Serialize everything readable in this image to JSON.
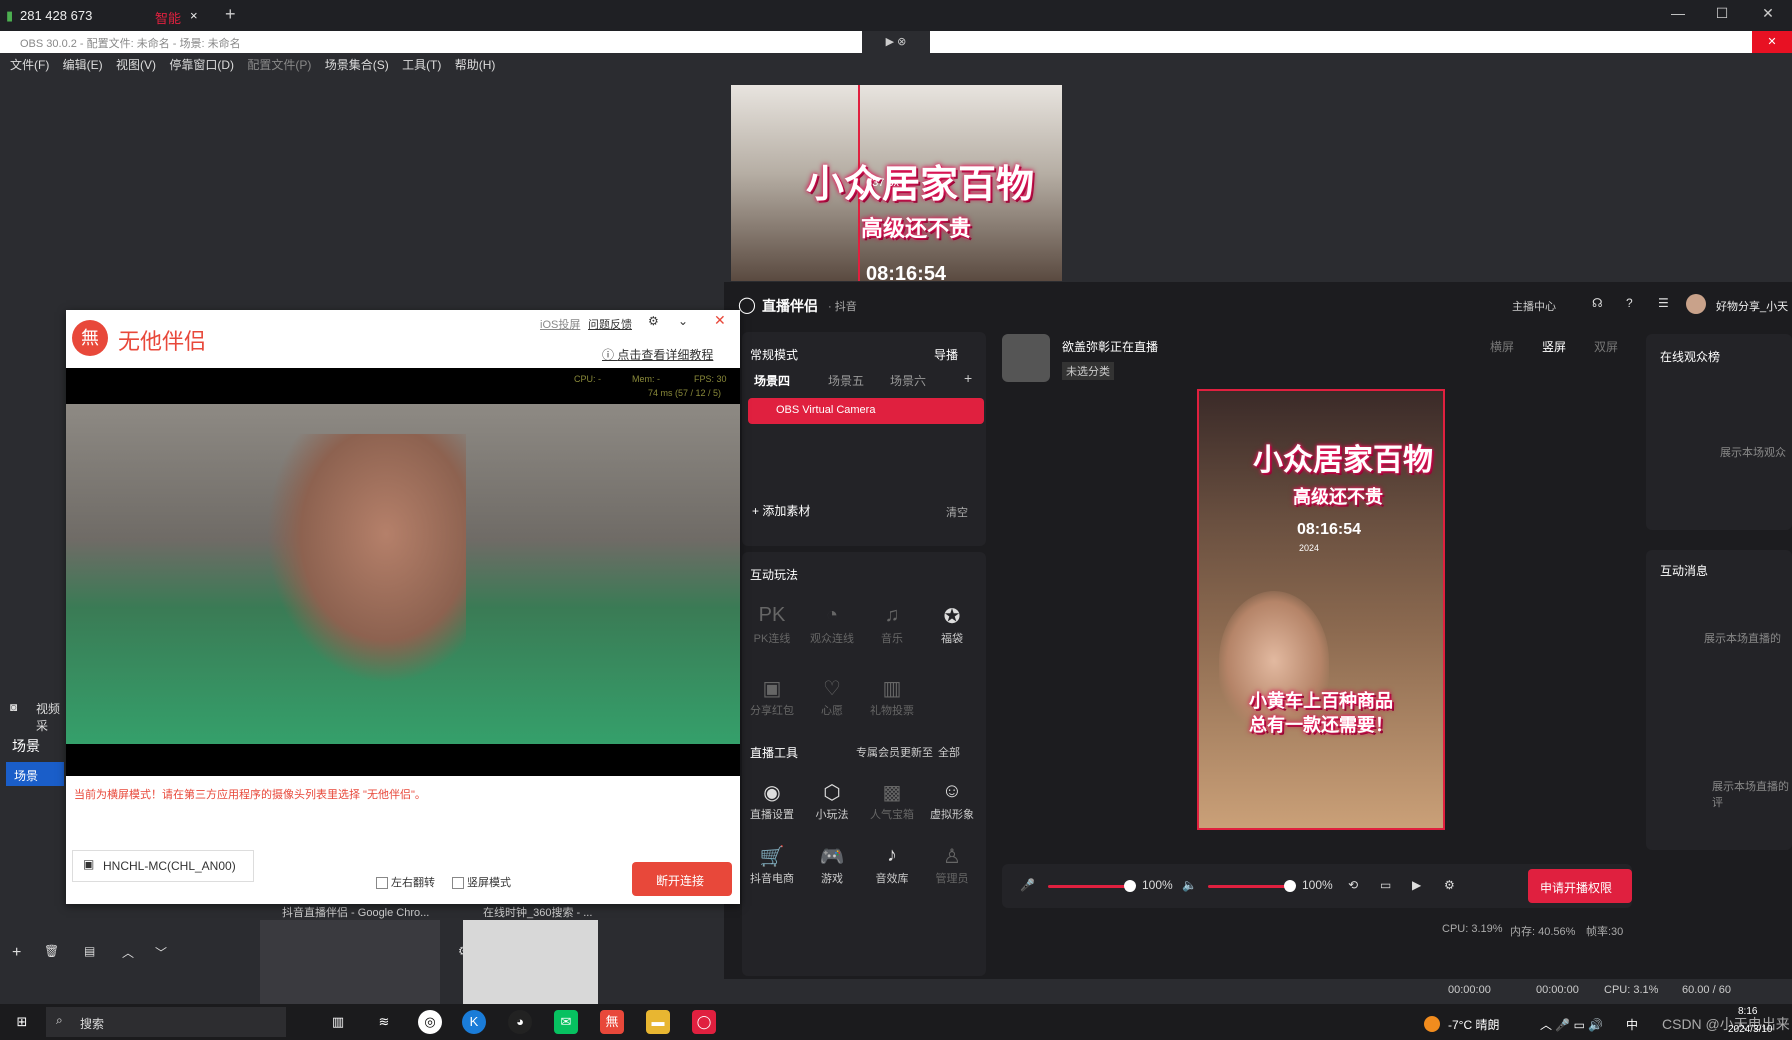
{
  "browser": {
    "tab_counter": "281 428 673",
    "tab_label": "智能",
    "new_tab": "+"
  },
  "obs": {
    "title": "OBS 30.0.2 - 配置文件: 未命名 - 场景: 未命名",
    "menu": [
      "文件(F)",
      "编辑(E)",
      "视图(V)",
      "停靠窗口(D)",
      "配置文件(P)",
      "场景集合(S)",
      "工具(T)",
      "帮助(H)"
    ],
    "left": {
      "video_label": "视频采",
      "scenes_header": "场景",
      "scene_item": "场景"
    },
    "status": {
      "t1": "00:00:00",
      "t2": "00:00:00",
      "cpu": "CPU: 3.1%",
      "fps": "60.00 / 60"
    }
  },
  "preview": {
    "title": "小众居家百物",
    "subtitle": "高级还不贵",
    "time": "08:16:54",
    "px": "637 px"
  },
  "wt": {
    "logo": "无他伴侣",
    "ios": "iOS投屏",
    "feedback": "问题反馈",
    "tutorial": "点击查看详细教程",
    "stats": {
      "cpu": "CPU: -",
      "mem": "Mem: -",
      "fps": "FPS: 30",
      "ms": "74 ms (57 / 12 / 5)"
    },
    "warning": "当前为横屏模式！请在第三方应用程序的摄像头列表里选择 \"无他伴侣\"。",
    "device": "HNCHL-MC(CHL_AN00)",
    "flip": "左右翻转",
    "portrait": "竖屏模式",
    "disconnect": "断开连接"
  },
  "thumbs": [
    "抖音直播伴侣 - Google Chro...",
    "在线时钟_360搜索 - ..."
  ],
  "zb": {
    "brand": "直播伴侣",
    "platform": "· 抖音",
    "header_right": [
      "主播中心",
      "好物分享_小天"
    ],
    "mode": "常规模式",
    "guide": "导播",
    "scenes": [
      "场景四",
      "场景五",
      "场景六"
    ],
    "source": "OBS Virtual Camera",
    "add_source": "添加素材",
    "clear": "清空",
    "interact_title": "互动玩法",
    "interact": [
      "PK连线",
      "观众连线",
      "音乐",
      "福袋",
      "分享红包",
      "心愿",
      "礼物投票"
    ],
    "tools_title": "直播工具",
    "tools_promo": "专属会员更新至",
    "tools_all": "全部",
    "tools": [
      "直播设置",
      "小玩法",
      "人气宝箱",
      "虚拟形象",
      "抖音电商",
      "游戏",
      "音效库",
      "管理员"
    ],
    "streamer": "欲盖弥彰正在直播",
    "category": "未选分类",
    "view_modes": [
      "横屏",
      "竖屏",
      "双屏"
    ],
    "mic_pct": "100%",
    "spk_pct": "100%",
    "apply": "申请开播权限",
    "sys": {
      "cpu": "CPU: 3.19%",
      "mem": "内存: 40.56%",
      "fps": "帧率:30"
    },
    "right": {
      "audience_title": "在线观众榜",
      "audience_empty": "展示本场观众",
      "msg_title": "互动消息",
      "msg_empty1": "展示本场直播的",
      "msg_empty2": "展示本场直播的评"
    }
  },
  "phone": {
    "title": "小众居家百物",
    "subtitle": "高级还不贵",
    "time": "08:16:54",
    "year": "2024",
    "caption1": "小黄车上百种商品",
    "caption2": "总有一款还需要！"
  },
  "taskbar": {
    "search": "搜索",
    "weather": "-7°C 晴朗",
    "ime": "中",
    "time": "8:16",
    "date": "2024/3/10",
    "watermark": "CSDN @小天电出来"
  },
  "colors": {
    "accent": "#e0203f",
    "wt_red": "#e8483a"
  }
}
